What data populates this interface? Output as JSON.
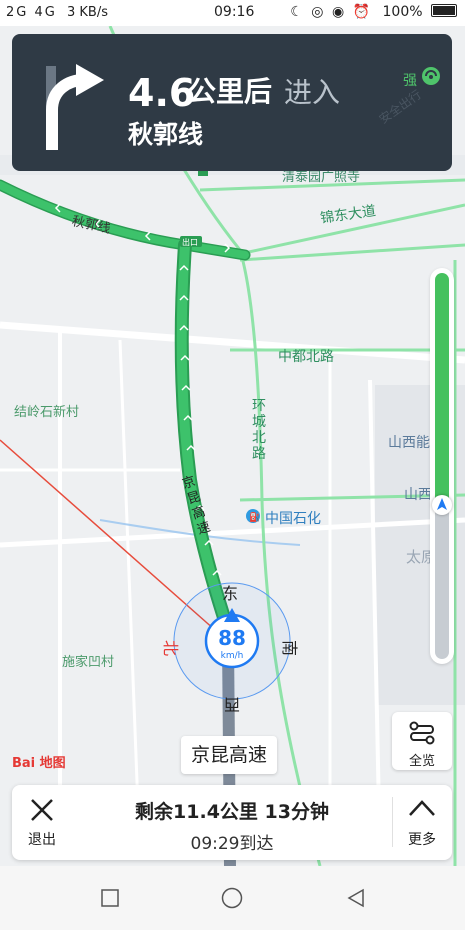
{
  "status_bar": {
    "signal": "2G 4G",
    "network_speed": "3 KB/s",
    "time": "09:16",
    "battery": "100%"
  },
  "navigation": {
    "distance": "4.6",
    "distance_unit": "公里后",
    "action": "进入",
    "road_name": "秋郭线",
    "gps_signal": "强",
    "watermark": "安全出行"
  },
  "map": {
    "labels": {
      "qiu_guo_line": "秋郭线",
      "qingtai_garden": "清泰园广照寺",
      "jindong_avenue": "锦东大道",
      "zhongdu_north_road": "中都北路",
      "jieling_shixin_village": "结岭石新村",
      "ring_north_road": "环城北路",
      "shanxi_energy": "山西能",
      "shanxi": "山西",
      "sinopec": "中国石化",
      "taiyuan": "太原",
      "jingkun_expressway": "京昆高速",
      "shijia_village": "施家凹村",
      "exit_tag": "出口"
    },
    "compass": {
      "north": "北",
      "east": "东",
      "south": "南",
      "west": "西"
    },
    "speed": "88",
    "speed_unit": "km/h",
    "current_road": "京昆高速",
    "logo": "Bai 地图"
  },
  "route_progress": 0.6,
  "overview_button": {
    "label": "全览"
  },
  "bottom_panel": {
    "exit_label": "退出",
    "remaining": "剩余11.4公里 13分钟",
    "arrival": "09:29到达",
    "more_label": "更多"
  },
  "colors": {
    "route": "#3dc26b",
    "card": "#2f3a45",
    "accent": "#1f7af2"
  }
}
